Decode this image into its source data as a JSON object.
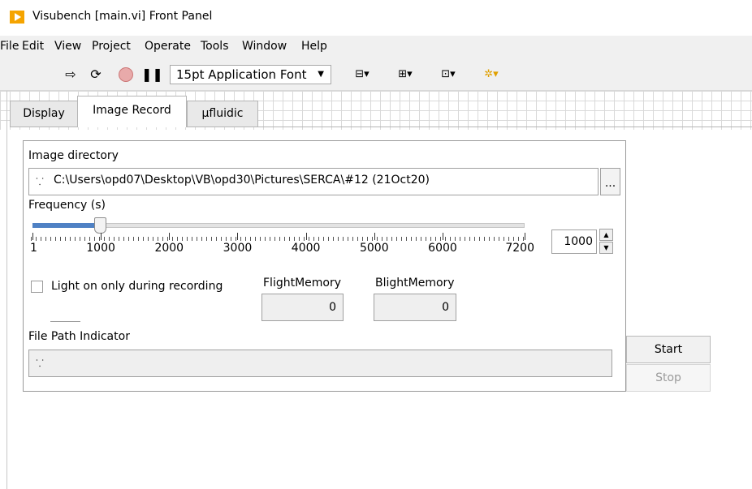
{
  "window": {
    "title": "Visubench [main.vi] Front Panel"
  },
  "menu": {
    "items": [
      "File",
      "Edit",
      "View",
      "Project",
      "Operate",
      "Tools",
      "Window",
      "Help"
    ]
  },
  "toolbar": {
    "icons": [
      "run-arrow-icon",
      "run-continuously-icon",
      "abort-icon",
      "pause-icon",
      "align-objects-icon",
      "distribute-objects-icon",
      "resize-objects-icon",
      "reorder-icon"
    ],
    "font_select": "15pt Application Font"
  },
  "tabs": [
    {
      "label": "Display",
      "active": false
    },
    {
      "label": "Image Record",
      "active": true
    },
    {
      "label": "µfluidic",
      "active": false
    }
  ],
  "image_directory": {
    "label": "Image directory",
    "value": "C:\\Users\\opd07\\Desktop\\VB\\opd30\\Pictures\\SERCA\\#12 (21Oct20)",
    "browse_label": "..."
  },
  "frequency": {
    "label": "Frequency (s)",
    "value": "1000",
    "min": 1,
    "max": 7200,
    "slider_value": 1000,
    "tick_labels": [
      "1",
      "1000",
      "2000",
      "3000",
      "4000",
      "5000",
      "6000",
      "7200"
    ]
  },
  "light_checkbox": {
    "label": "Light on only during recording",
    "checked": false
  },
  "flight_memory": {
    "label": "FlightMemory",
    "value": "0"
  },
  "blight_memory": {
    "label": "BlightMemory",
    "value": "0"
  },
  "file_path_indicator": {
    "label": "File Path Indicator",
    "value": ""
  },
  "buttons": {
    "start": "Start",
    "stop": "Stop"
  },
  "colors": {
    "app_icon": "#f5a400",
    "slider_fill": "#4f81c4"
  }
}
